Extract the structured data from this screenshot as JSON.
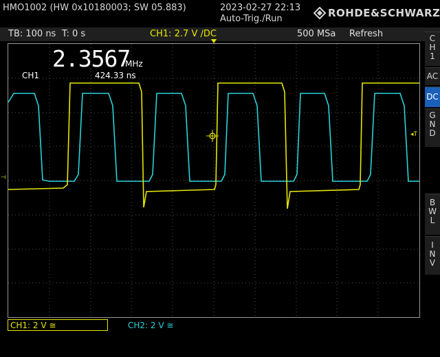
{
  "header": {
    "model": "HMO1002 (HW 0x10180003; SW 05.883)",
    "datetime": "2023-02-27 22:13",
    "trigger_mode": "Auto-Trig./Run",
    "brand": "ROHDE&SCHWARZ"
  },
  "status": {
    "timebase": "TB: 100 ns",
    "trigger_time": "T: 0 s",
    "ch1_trigger": "CH1: 2.7 V ∕DC",
    "sample_rate": "500 MSa",
    "acq_mode": "Refresh"
  },
  "measurement": {
    "frequency_value": "2.3567",
    "frequency_unit": "MHz",
    "period": "424.33 ns",
    "channel_label": "CH1"
  },
  "side_menu": {
    "ch1": "C\nH\n1",
    "ac": "AC",
    "dc": "DC",
    "gnd": "G\nN\nD",
    "bwl": "B\nW\nL",
    "inv": "I\nN\nV"
  },
  "footer": {
    "ch1_scale": "CH1: 2 V ≅",
    "ch2_scale": "CH2: 2 V ≅"
  },
  "colors": {
    "ch1": "#e8e800",
    "ch2": "#2ad4dc",
    "active_button": "#1a5fb8"
  },
  "waveforms": {
    "ch1": {
      "color": "#e8e800",
      "high_level": "high",
      "low_level": "low",
      "rising_edges": [
        1,
        5
      ],
      "falling_edges": [
        2
      ]
    },
    "ch2": {
      "color": "#2ad4dc",
      "high_level": "high",
      "low_level": "low"
    }
  }
}
